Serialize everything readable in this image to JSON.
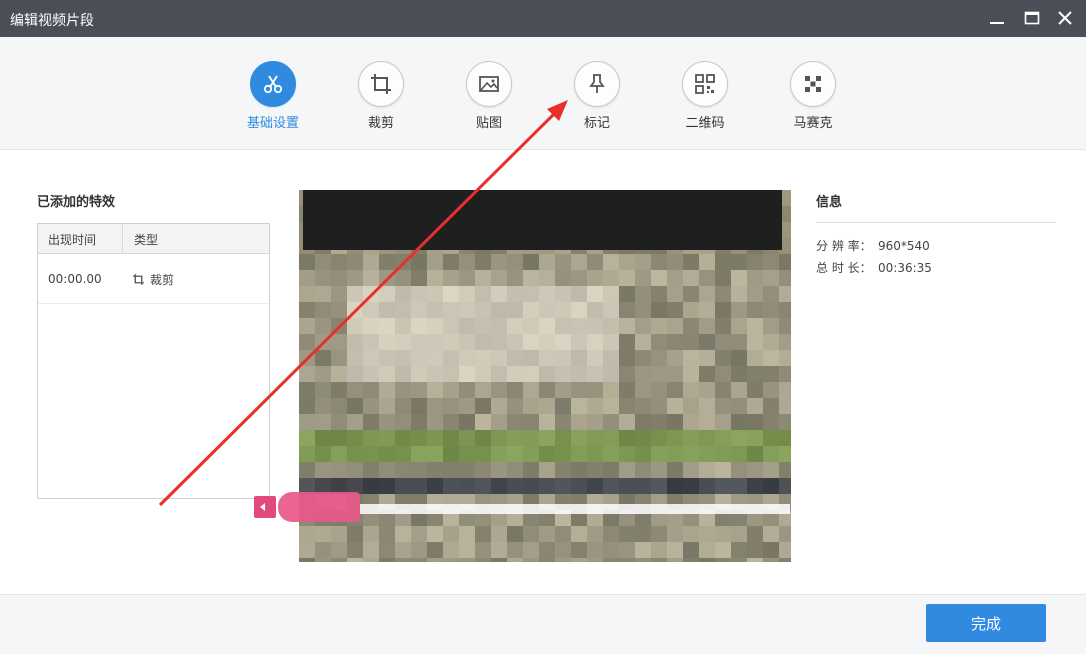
{
  "window": {
    "title": "编辑视频片段"
  },
  "toolbar": {
    "items": [
      {
        "label": "基础设置",
        "icon": "scissors-icon",
        "active": true
      },
      {
        "label": "裁剪",
        "icon": "crop-icon"
      },
      {
        "label": "贴图",
        "icon": "image-icon"
      },
      {
        "label": "标记",
        "icon": "pin-icon"
      },
      {
        "label": "二维码",
        "icon": "qrcode-icon"
      },
      {
        "label": "马赛克",
        "icon": "mosaic-icon"
      }
    ]
  },
  "effects": {
    "title": "已添加的特效",
    "columns": [
      "出现时间",
      "类型"
    ],
    "rows": [
      {
        "time": "00:00.00",
        "type": "裁剪",
        "icon": "crop-icon"
      }
    ]
  },
  "info": {
    "title": "信息",
    "resolution_label": "分 辨 率：",
    "resolution_value": "960*540",
    "duration_label": "总 时 长：",
    "duration_value": "00:36:35"
  },
  "footer": {
    "done_label": "完成"
  },
  "colors": {
    "accent": "#2f8ae0",
    "titlebar": "#4a4f57",
    "marker": "#e14b7b",
    "arrow": "#e8302a"
  }
}
